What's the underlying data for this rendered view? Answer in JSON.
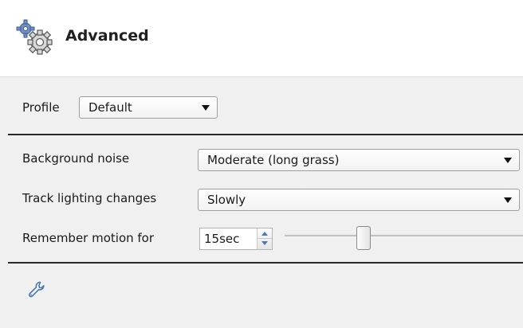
{
  "header": {
    "title": "Advanced",
    "icon": "gear-icon"
  },
  "profile": {
    "label": "Profile",
    "value": "Default"
  },
  "background_noise": {
    "label": "Background noise",
    "value": "Moderate (long grass)"
  },
  "track_lighting": {
    "label": "Track lighting changes",
    "value": "Slowly"
  },
  "remember_motion": {
    "label": "Remember motion for",
    "value": "15sec",
    "slider_level": 0.33
  },
  "footer": {
    "icon": "wrench-icon"
  },
  "colors": {
    "accent": "#4a78b5",
    "divider": "#2a2a2a",
    "panel": "#f0f0f0"
  }
}
